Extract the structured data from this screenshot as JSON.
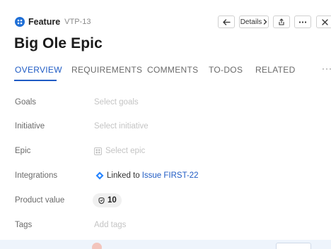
{
  "header": {
    "type_label": "Feature",
    "record_id": "VTP-13",
    "details_label": "Details",
    "title": "Big Ole Epic"
  },
  "tabs": [
    {
      "label": "OVERVIEW",
      "active": true
    },
    {
      "label": "REQUIREMENTS",
      "active": false
    },
    {
      "label": "COMMENTS",
      "active": false
    },
    {
      "label": "TO-DOS",
      "active": false
    },
    {
      "label": "RELATED",
      "active": false
    }
  ],
  "tabs_more": "···",
  "fields": {
    "goals": {
      "label": "Goals",
      "placeholder": "Select goals"
    },
    "initiative": {
      "label": "Initiative",
      "placeholder": "Select initiative"
    },
    "epic": {
      "label": "Epic",
      "placeholder": "Select epic"
    },
    "integrations": {
      "label": "Integrations",
      "linked_text": "Linked to",
      "link_text": "Issue FIRST-22"
    },
    "product_value": {
      "label": "Product value",
      "value": "10"
    },
    "tags": {
      "label": "Tags",
      "placeholder": "Add tags"
    }
  },
  "colors": {
    "accent": "#1f5bc4",
    "type_icon": "#1f6fd6",
    "jira_icon": "#2684ff"
  },
  "icons": {
    "back": "arrow-left-icon",
    "details_chevron": "chevron-right-icon",
    "share": "share-icon",
    "more": "more-horizontal-icon",
    "close": "close-icon",
    "epic": "epic-grid-icon",
    "jira": "jira-diamond-icon",
    "product_value": "score-icon"
  }
}
